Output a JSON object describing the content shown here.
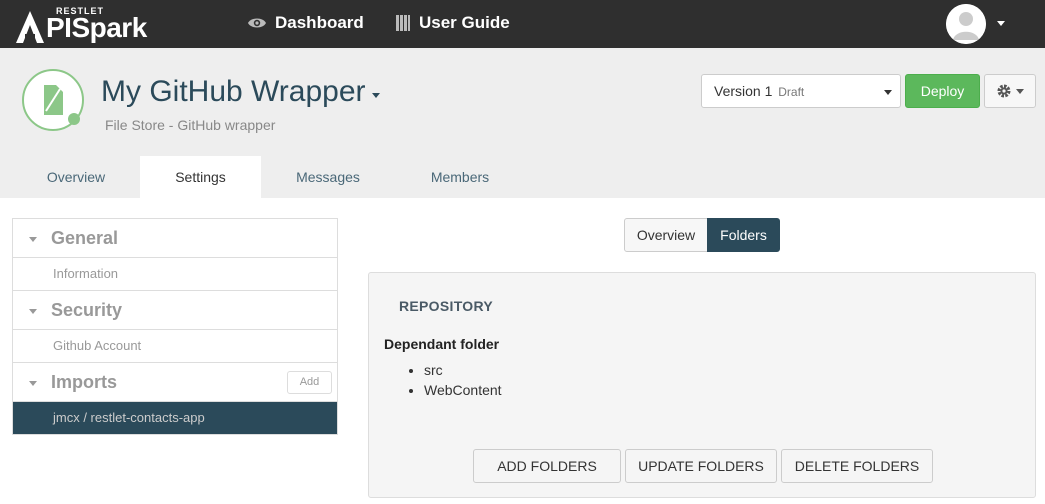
{
  "brand": {
    "restlet": "RESTLET",
    "name": "PISpark"
  },
  "topnav": {
    "dashboard": "Dashboard",
    "user_guide": "User Guide"
  },
  "api": {
    "name": "My GitHub Wrapper",
    "subtitle": "File Store - GitHub wrapper"
  },
  "version": {
    "label": "Version 1",
    "status": "Draft"
  },
  "deploy_label": "Deploy",
  "tabs": [
    "Overview",
    "Settings",
    "Messages",
    "Members"
  ],
  "sidebar": {
    "general": {
      "title": "General",
      "items": [
        "Information"
      ]
    },
    "security": {
      "title": "Security",
      "items": [
        "Github Account"
      ]
    },
    "imports": {
      "title": "Imports",
      "add_label": "Add",
      "items": [
        "jmcx / restlet-contacts-app"
      ]
    }
  },
  "segments": [
    "Overview",
    "Folders"
  ],
  "repository": {
    "title": "REPOSITORY",
    "dependant_title": "Dependant folder",
    "folders": [
      "src",
      "WebContent"
    ],
    "buttons": {
      "add": "ADD FOLDERS",
      "update": "UPDATE FOLDERS",
      "delete": "DELETE FOLDERS"
    }
  },
  "colors": {
    "navbar": "#2f2f2f",
    "accent": "#2b4a5a",
    "deploy": "#5cb85c",
    "icon_green": "#8cc788"
  }
}
